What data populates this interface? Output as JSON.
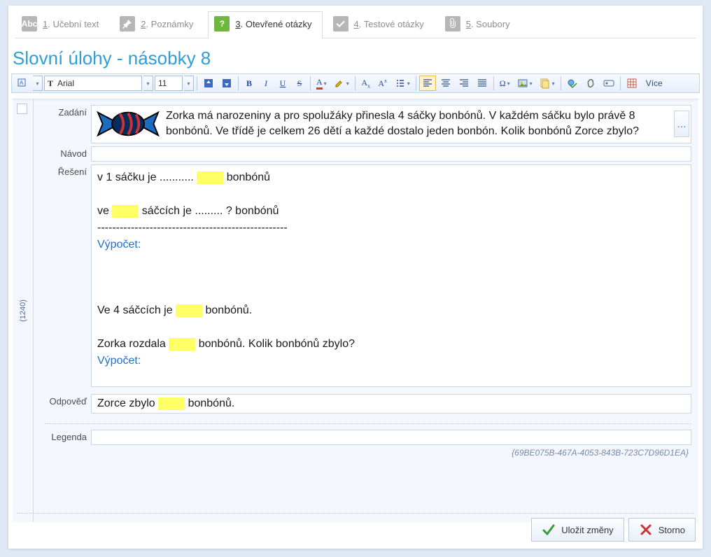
{
  "tabs": [
    {
      "label": "1. Učební text",
      "accel": "1"
    },
    {
      "label": "2. Poznámky",
      "accel": "2"
    },
    {
      "label": "3. Otevřené otázky",
      "accel": "3"
    },
    {
      "label": "4. Testové otázky",
      "accel": "4"
    },
    {
      "label": "5. Soubory",
      "accel": "5"
    }
  ],
  "page_title": "Slovní úlohy - násobky 8",
  "toolbar": {
    "font_name": "Arial",
    "font_size": "11",
    "more_label": "Více"
  },
  "side_id": "(1240)",
  "labels": {
    "zadani": "Zadání",
    "navod": "Návod",
    "reseni": "Řešení",
    "odpoved": "Odpověď",
    "legenda": "Legenda"
  },
  "zadani_text": "Zorka má narozeniny a pro spolužáky přinesla 4 sáčky bonbónů. V každém sáčku bylo právě 8 bonbónů. Ve třídě je celkem 26 dětí a každé dostalo jeden bonbón. Kolik bonbónů Zorce zbylo?",
  "reseni": {
    "l1a": "v 1 sáčku je ........... ",
    "l1b": " bonbónů",
    "l2a": "ve ",
    "l2b": " sáčcích je ......... ? bonbónů",
    "dashes": "---------------------------------------------------",
    "vypocet": "Výpočet:",
    "l3a": "Ve 4 sáčcích je ",
    "l3b": " bonbónů.",
    "l4a": "Zorka rozdala ",
    "l4b": " bonbónů. Kolik bonbónů zbylo?"
  },
  "odpoved": {
    "a": "Zorce zbylo ",
    "b": " bonbónů."
  },
  "guid": "{69BE075B-467A-4053-843B-723C7D96D1EA}",
  "footer": {
    "save": "Uložit změny",
    "cancel": "Storno"
  }
}
